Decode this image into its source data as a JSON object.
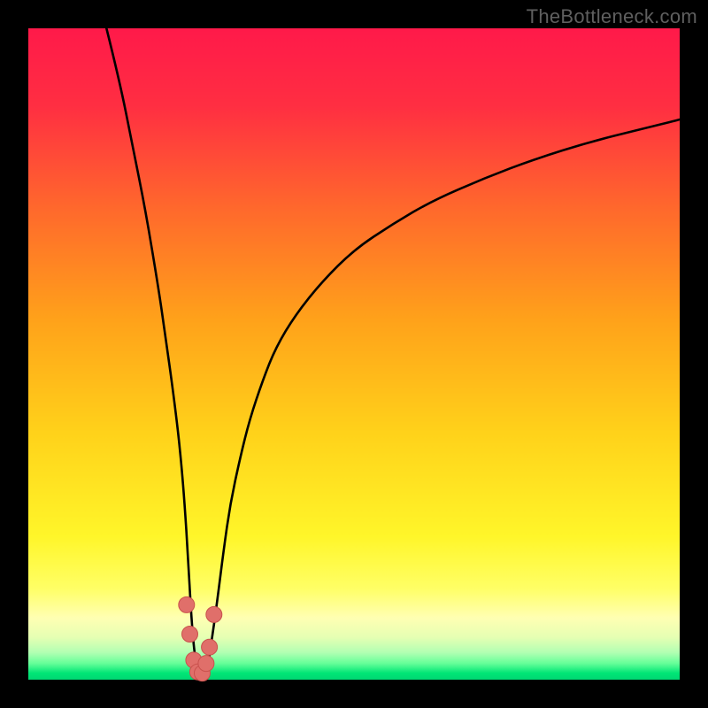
{
  "watermark": "TheBottleneck.com",
  "colors": {
    "black": "#000000",
    "curve": "#000000",
    "marker_fill": "#e06f6a",
    "marker_stroke": "#c9514d",
    "gradient_stops": [
      {
        "offset": 0.0,
        "color": "#ff1a4a"
      },
      {
        "offset": 0.12,
        "color": "#ff2f42"
      },
      {
        "offset": 0.28,
        "color": "#ff6a2c"
      },
      {
        "offset": 0.45,
        "color": "#ffa31a"
      },
      {
        "offset": 0.62,
        "color": "#ffd21a"
      },
      {
        "offset": 0.78,
        "color": "#fff62a"
      },
      {
        "offset": 0.86,
        "color": "#ffff66"
      },
      {
        "offset": 0.905,
        "color": "#ffffb3"
      },
      {
        "offset": 0.935,
        "color": "#e6ffb3"
      },
      {
        "offset": 0.958,
        "color": "#b3ffb3"
      },
      {
        "offset": 0.975,
        "color": "#66ff99"
      },
      {
        "offset": 0.99,
        "color": "#00e676"
      },
      {
        "offset": 1.0,
        "color": "#00d873"
      }
    ]
  },
  "chart_data": {
    "type": "line",
    "title": "",
    "xlabel": "",
    "ylabel": "",
    "xlim": [
      0,
      100
    ],
    "ylim": [
      0,
      100
    ],
    "grid": false,
    "series": [
      {
        "name": "bottleneck-curve",
        "x": [
          12,
          14,
          16,
          18,
          20,
          21,
          22,
          23,
          23.5,
          24,
          24.5,
          25,
          25.5,
          26,
          26.5,
          27,
          27.5,
          28,
          29,
          30,
          31,
          32.5,
          34,
          36,
          38,
          41,
          45,
          50,
          56,
          62,
          70,
          78,
          86,
          94,
          100
        ],
        "y": [
          100,
          92,
          82,
          72,
          60,
          53,
          46,
          38,
          33,
          27,
          19,
          10,
          4,
          1.5,
          0.2,
          0.2,
          1.5,
          5,
          12,
          20,
          27,
          34,
          40,
          46,
          51,
          56,
          61,
          66,
          70,
          73.5,
          77,
          80,
          82.5,
          84.5,
          86
        ]
      }
    ],
    "markers": {
      "name": "highlight-points",
      "points": [
        {
          "x": 24.3,
          "y": 11.5
        },
        {
          "x": 24.8,
          "y": 7.0
        },
        {
          "x": 25.4,
          "y": 3.0
        },
        {
          "x": 26.0,
          "y": 1.2
        },
        {
          "x": 26.7,
          "y": 1.0
        },
        {
          "x": 27.3,
          "y": 2.5
        },
        {
          "x": 27.8,
          "y": 5.0
        },
        {
          "x": 28.5,
          "y": 10.0
        }
      ]
    }
  }
}
